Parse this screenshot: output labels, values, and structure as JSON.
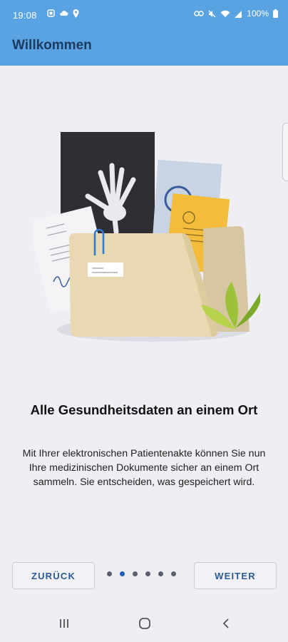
{
  "status_bar": {
    "time": "19:08",
    "battery": "100%",
    "left_icons": [
      "notification-icon",
      "cloud-icon",
      "location-icon"
    ],
    "right_icons": [
      "link-icon",
      "mute-icon",
      "wifi-icon",
      "signal-icon",
      "battery-icon"
    ]
  },
  "app_bar": {
    "title": "Willkommen"
  },
  "onboarding": {
    "headline": "Alle Gesundheitsdaten an einem Ort",
    "description": "Mit Ihrer elektronischen Patientenakte können Sie nun Ihre medizinischen Dokumente sicher an einem Ort sammeln. Sie entscheiden, was gespeichert wird.",
    "current_page": 2,
    "total_pages": 6
  },
  "buttons": {
    "back": "ZURÜCK",
    "next": "WEITER"
  },
  "colors": {
    "app_bar": "#5aa3e3",
    "accent": "#1f5fb8",
    "background": "#eeeef3"
  }
}
